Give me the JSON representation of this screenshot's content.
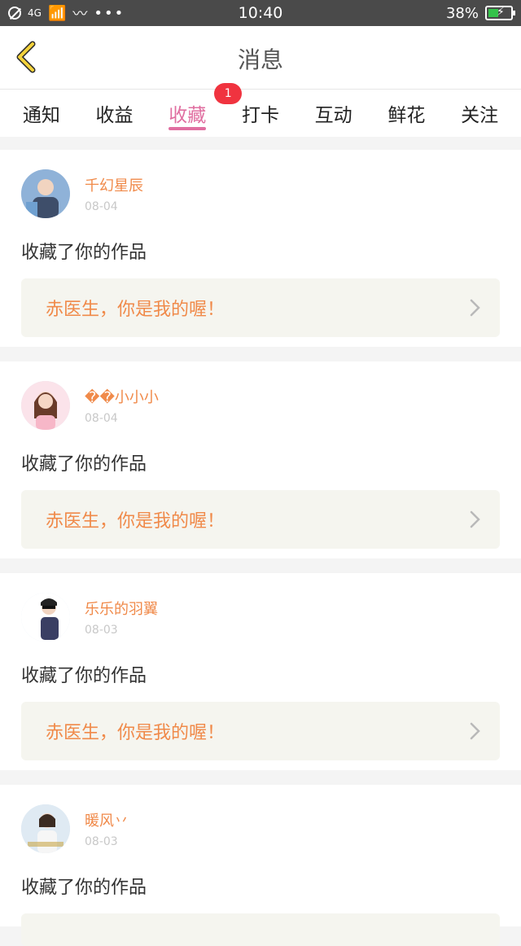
{
  "status_bar": {
    "time": "10:40",
    "signal_text": "4G",
    "battery_text": "38%"
  },
  "header": {
    "title": "消息"
  },
  "tabs": [
    {
      "label": "通知"
    },
    {
      "label": "收益"
    },
    {
      "label": "收藏",
      "active": true,
      "badge": "1"
    },
    {
      "label": "打卡"
    },
    {
      "label": "互动"
    },
    {
      "label": "鲜花"
    },
    {
      "label": "关注"
    }
  ],
  "feed": [
    {
      "username": "千幻星辰",
      "date": "08-04",
      "action": "收藏了你的作品",
      "work_title": "赤医生，你是我的喔！"
    },
    {
      "username": "��小小小",
      "date": "08-04",
      "action": "收藏了你的作品",
      "work_title": "赤医生，你是我的喔！"
    },
    {
      "username": "乐乐的羽翼",
      "date": "08-03",
      "action": "收藏了你的作品",
      "work_title": "赤医生，你是我的喔！"
    },
    {
      "username": "暖风丷",
      "date": "08-03",
      "action": "收藏了你的作品"
    }
  ],
  "colors": {
    "accent_pink": "#e06ea0",
    "name_orange": "#f08a4a",
    "badge_red": "#f0333f"
  },
  "icons": {
    "back": "chevron-left-icon",
    "arrow": "chevron-right-icon"
  }
}
